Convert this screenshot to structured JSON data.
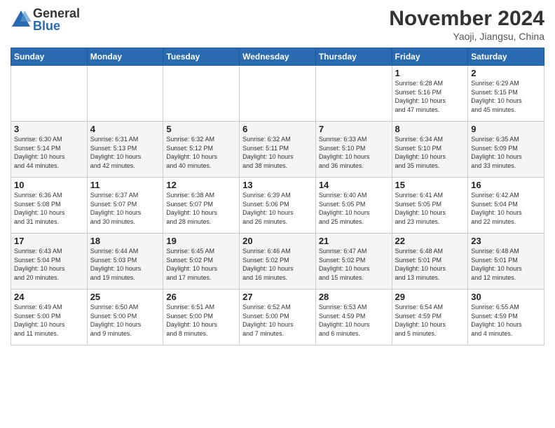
{
  "header": {
    "logo_general": "General",
    "logo_blue": "Blue",
    "title": "November 2024",
    "location": "Yaoji, Jiangsu, China"
  },
  "weekdays": [
    "Sunday",
    "Monday",
    "Tuesday",
    "Wednesday",
    "Thursday",
    "Friday",
    "Saturday"
  ],
  "weeks": [
    [
      {
        "day": "",
        "info": ""
      },
      {
        "day": "",
        "info": ""
      },
      {
        "day": "",
        "info": ""
      },
      {
        "day": "",
        "info": ""
      },
      {
        "day": "",
        "info": ""
      },
      {
        "day": "1",
        "info": "Sunrise: 6:28 AM\nSunset: 5:16 PM\nDaylight: 10 hours\nand 47 minutes."
      },
      {
        "day": "2",
        "info": "Sunrise: 6:29 AM\nSunset: 5:15 PM\nDaylight: 10 hours\nand 45 minutes."
      }
    ],
    [
      {
        "day": "3",
        "info": "Sunrise: 6:30 AM\nSunset: 5:14 PM\nDaylight: 10 hours\nand 44 minutes."
      },
      {
        "day": "4",
        "info": "Sunrise: 6:31 AM\nSunset: 5:13 PM\nDaylight: 10 hours\nand 42 minutes."
      },
      {
        "day": "5",
        "info": "Sunrise: 6:32 AM\nSunset: 5:12 PM\nDaylight: 10 hours\nand 40 minutes."
      },
      {
        "day": "6",
        "info": "Sunrise: 6:32 AM\nSunset: 5:11 PM\nDaylight: 10 hours\nand 38 minutes."
      },
      {
        "day": "7",
        "info": "Sunrise: 6:33 AM\nSunset: 5:10 PM\nDaylight: 10 hours\nand 36 minutes."
      },
      {
        "day": "8",
        "info": "Sunrise: 6:34 AM\nSunset: 5:10 PM\nDaylight: 10 hours\nand 35 minutes."
      },
      {
        "day": "9",
        "info": "Sunrise: 6:35 AM\nSunset: 5:09 PM\nDaylight: 10 hours\nand 33 minutes."
      }
    ],
    [
      {
        "day": "10",
        "info": "Sunrise: 6:36 AM\nSunset: 5:08 PM\nDaylight: 10 hours\nand 31 minutes."
      },
      {
        "day": "11",
        "info": "Sunrise: 6:37 AM\nSunset: 5:07 PM\nDaylight: 10 hours\nand 30 minutes."
      },
      {
        "day": "12",
        "info": "Sunrise: 6:38 AM\nSunset: 5:07 PM\nDaylight: 10 hours\nand 28 minutes."
      },
      {
        "day": "13",
        "info": "Sunrise: 6:39 AM\nSunset: 5:06 PM\nDaylight: 10 hours\nand 26 minutes."
      },
      {
        "day": "14",
        "info": "Sunrise: 6:40 AM\nSunset: 5:05 PM\nDaylight: 10 hours\nand 25 minutes."
      },
      {
        "day": "15",
        "info": "Sunrise: 6:41 AM\nSunset: 5:05 PM\nDaylight: 10 hours\nand 23 minutes."
      },
      {
        "day": "16",
        "info": "Sunrise: 6:42 AM\nSunset: 5:04 PM\nDaylight: 10 hours\nand 22 minutes."
      }
    ],
    [
      {
        "day": "17",
        "info": "Sunrise: 6:43 AM\nSunset: 5:04 PM\nDaylight: 10 hours\nand 20 minutes."
      },
      {
        "day": "18",
        "info": "Sunrise: 6:44 AM\nSunset: 5:03 PM\nDaylight: 10 hours\nand 19 minutes."
      },
      {
        "day": "19",
        "info": "Sunrise: 6:45 AM\nSunset: 5:02 PM\nDaylight: 10 hours\nand 17 minutes."
      },
      {
        "day": "20",
        "info": "Sunrise: 6:46 AM\nSunset: 5:02 PM\nDaylight: 10 hours\nand 16 minutes."
      },
      {
        "day": "21",
        "info": "Sunrise: 6:47 AM\nSunset: 5:02 PM\nDaylight: 10 hours\nand 15 minutes."
      },
      {
        "day": "22",
        "info": "Sunrise: 6:48 AM\nSunset: 5:01 PM\nDaylight: 10 hours\nand 13 minutes."
      },
      {
        "day": "23",
        "info": "Sunrise: 6:48 AM\nSunset: 5:01 PM\nDaylight: 10 hours\nand 12 minutes."
      }
    ],
    [
      {
        "day": "24",
        "info": "Sunrise: 6:49 AM\nSunset: 5:00 PM\nDaylight: 10 hours\nand 11 minutes."
      },
      {
        "day": "25",
        "info": "Sunrise: 6:50 AM\nSunset: 5:00 PM\nDaylight: 10 hours\nand 9 minutes."
      },
      {
        "day": "26",
        "info": "Sunrise: 6:51 AM\nSunset: 5:00 PM\nDaylight: 10 hours\nand 8 minutes."
      },
      {
        "day": "27",
        "info": "Sunrise: 6:52 AM\nSunset: 5:00 PM\nDaylight: 10 hours\nand 7 minutes."
      },
      {
        "day": "28",
        "info": "Sunrise: 6:53 AM\nSunset: 4:59 PM\nDaylight: 10 hours\nand 6 minutes."
      },
      {
        "day": "29",
        "info": "Sunrise: 6:54 AM\nSunset: 4:59 PM\nDaylight: 10 hours\nand 5 minutes."
      },
      {
        "day": "30",
        "info": "Sunrise: 6:55 AM\nSunset: 4:59 PM\nDaylight: 10 hours\nand 4 minutes."
      }
    ]
  ]
}
